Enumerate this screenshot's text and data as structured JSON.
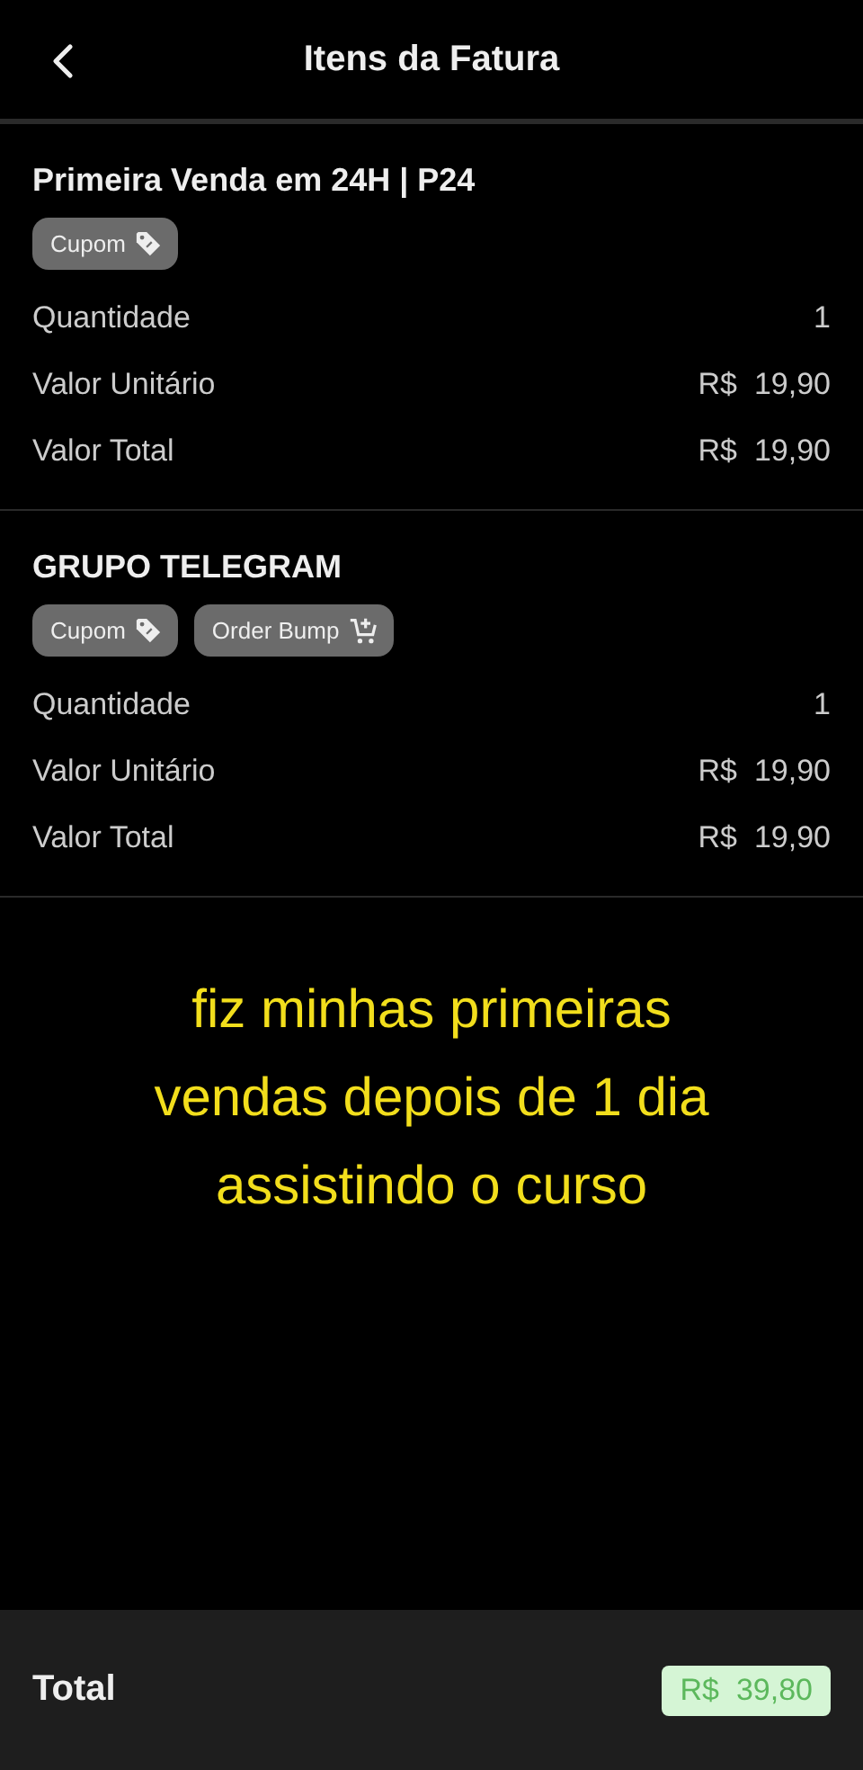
{
  "header": {
    "title": "Itens da Fatura"
  },
  "items": [
    {
      "name": "Primeira Venda em 24H | P24",
      "tags": [
        {
          "label": "Cupom",
          "kind": "coupon"
        }
      ],
      "rows": [
        {
          "label": "Quantidade",
          "value": "1"
        },
        {
          "label": "Valor Unitário",
          "value": "R$  19,90"
        },
        {
          "label": "Valor Total",
          "value": "R$  19,90"
        }
      ]
    },
    {
      "name": "GRUPO TELEGRAM",
      "tags": [
        {
          "label": "Cupom",
          "kind": "coupon"
        },
        {
          "label": "Order Bump",
          "kind": "bump"
        }
      ],
      "rows": [
        {
          "label": "Quantidade",
          "value": "1"
        },
        {
          "label": "Valor Unitário",
          "value": "R$  19,90"
        },
        {
          "label": "Valor Total",
          "value": "R$  19,90"
        }
      ]
    }
  ],
  "caption": [
    "fiz minhas primeiras",
    "vendas depois de 1 dia",
    "assistindo o curso"
  ],
  "footer": {
    "label": "Total",
    "value": "R$  39,80"
  }
}
